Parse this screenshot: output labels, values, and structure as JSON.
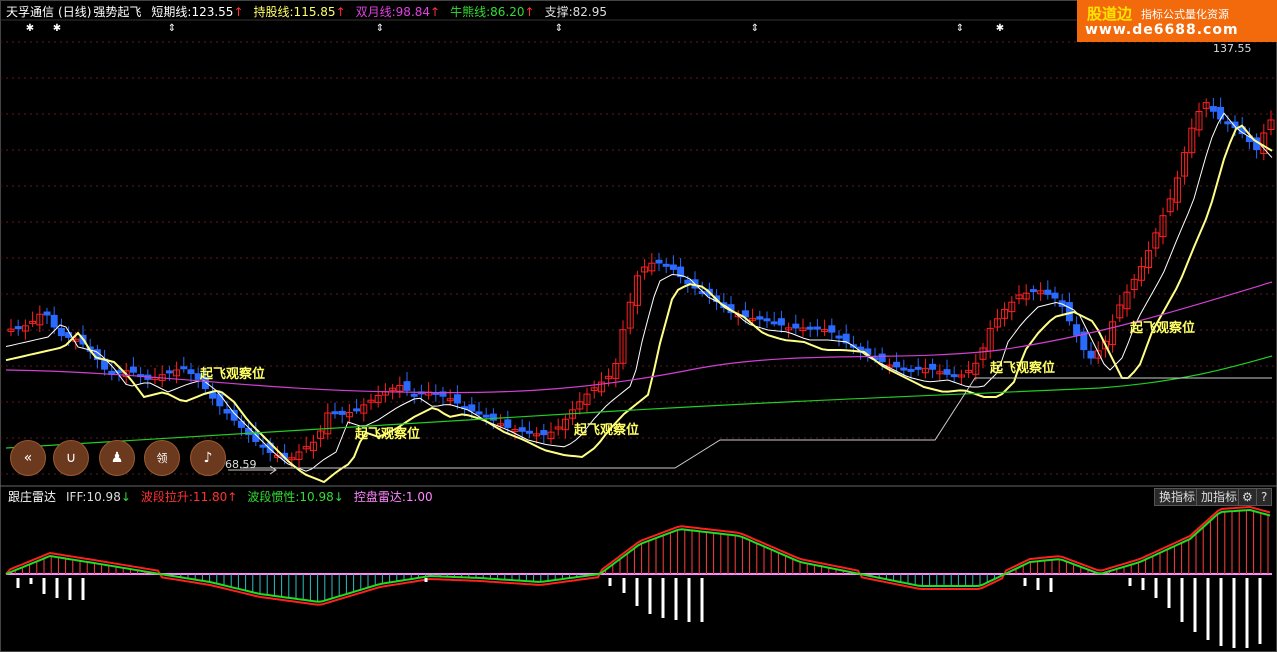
{
  "header": {
    "stock": "天孚通信",
    "period": "(日线)",
    "indicator": "强势起飞",
    "items": [
      {
        "label": "短期线:123.55",
        "arrow": "↑",
        "color": "#ffffff"
      },
      {
        "label": "持股线:115.85",
        "arrow": "↑",
        "color": "#ffff66"
      },
      {
        "label": "双月线:98.84",
        "arrow": "↑",
        "color": "#e040e0"
      },
      {
        "label": "牛熊线:86.20",
        "arrow": "↑",
        "color": "#33dd33"
      },
      {
        "label": "支撑:82.95",
        "arrow": "",
        "color": "#dddddd"
      }
    ]
  },
  "logo": {
    "title": "股道边",
    "tagline": "指标公式量化资源",
    "url": "www.de6688.com"
  },
  "price_labels": {
    "high": "137.55",
    "low": "68.59"
  },
  "signal_label": "起飞观察位",
  "tools": [
    {
      "name": "collapse-icon",
      "glyph": "«"
    },
    {
      "name": "magnet-icon",
      "glyph": "∪"
    },
    {
      "name": "advisor-icon",
      "glyph": "♟"
    },
    {
      "name": "crown-icon",
      "glyph": "领"
    },
    {
      "name": "bell-icon",
      "glyph": "♪"
    }
  ],
  "sub": {
    "title": "跟庄雷达",
    "items": [
      {
        "label": "IFF:10.98",
        "arrow": "↓",
        "color": "#dddddd",
        "acolor": "#33dd33"
      },
      {
        "label": "波段拉升:11.80",
        "arrow": "↑",
        "color": "#ff3333",
        "acolor": "#ff3333"
      },
      {
        "label": "波段惯性:10.98",
        "arrow": "↓",
        "color": "#33dd33",
        "acolor": "#33dd33"
      },
      {
        "label": "控盘雷达:1.00",
        "arrow": "",
        "color": "#ff88ff",
        "acolor": "#ff88ff"
      }
    ],
    "buttons": [
      "换指标",
      "加指标"
    ]
  },
  "colors": {
    "up": "#ff2020",
    "down": "#2a6aff",
    "short": "#ffffff",
    "hold": "#ffff88",
    "month": "#d040d0",
    "bull": "#22cc22",
    "support": "#cccccc"
  }
}
